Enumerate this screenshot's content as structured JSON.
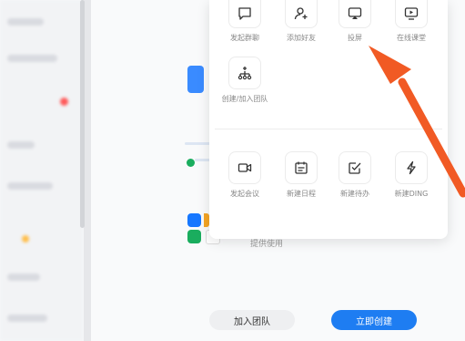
{
  "menu": {
    "row1": [
      {
        "label": "发起群聊",
        "icon": "chat-bubble-icon"
      },
      {
        "label": "添加好友",
        "icon": "add-user-icon"
      },
      {
        "label": "投屏",
        "icon": "screen-cast-icon"
      },
      {
        "label": "在线课堂",
        "icon": "online-class-icon"
      }
    ],
    "row2": [
      {
        "label": "创建/加入团队",
        "icon": "team-org-icon"
      }
    ],
    "row3": [
      {
        "label": "发起会议",
        "icon": "video-camera-icon"
      },
      {
        "label": "新建日程",
        "icon": "calendar-icon"
      },
      {
        "label": "新建待办",
        "icon": "todo-check-icon"
      },
      {
        "label": "新建DING",
        "icon": "lightning-icon"
      }
    ]
  },
  "footer": {
    "join_label": "加入团队",
    "create_label": "立即创建"
  },
  "background": {
    "hint_text": "提供使用"
  },
  "colors": {
    "accent": "#1e7df2",
    "arrow": "#f15a24"
  }
}
